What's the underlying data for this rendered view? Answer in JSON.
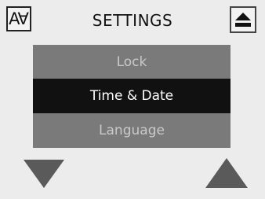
{
  "header": {
    "title": "SETTINGS",
    "font_button_glyph": "A∀",
    "font_button_icon": "font-size-icon",
    "eject_icon": "eject-icon"
  },
  "menu": {
    "items": [
      {
        "label": "Lock",
        "selected": false
      },
      {
        "label": "Time & Date",
        "selected": true
      },
      {
        "label": "Language",
        "selected": false
      }
    ]
  },
  "navigation": {
    "down_icon": "triangle-down-icon",
    "up_icon": "triangle-up-icon"
  },
  "colors": {
    "background": "#ececec",
    "selected_row": "#111111",
    "unselected_row": "#7a7a7a",
    "unselected_text": "#c9c9c9",
    "selected_text": "#ffffff",
    "arrow": "#5a5a5a"
  }
}
